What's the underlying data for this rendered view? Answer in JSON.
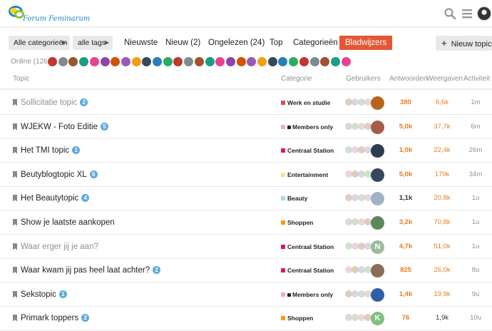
{
  "header": {
    "logo_text": "Forum Feminarum",
    "icons": [
      "search-icon",
      "hamburger-menu-icon",
      "user-avatar"
    ]
  },
  "nav": {
    "categories_dropdown": "Alle categorieën",
    "tags_dropdown": "alle tags",
    "links": [
      "Nieuwste",
      "Nieuw (2)",
      "Ongelezen (24)",
      "Top",
      "Categorieën",
      "Bladwijzers"
    ],
    "active_link": "Bladwijzers",
    "new_topic_label": "Nieuw topic",
    "accent_color": "#e45735"
  },
  "online": {
    "label": "Online (126)"
  },
  "table": {
    "headers": {
      "topic": "Topic",
      "category": "Categorie",
      "users": "Gebruikers",
      "replies": "Antwoorden",
      "views": "Weergaven",
      "activity": "Activiteit"
    },
    "rows": [
      {
        "title": "Sollicitatie topic",
        "badge": "2",
        "read": true,
        "category": "Werk en studie",
        "cat_color": "#e74c3c",
        "locked": false,
        "replies": "380",
        "views": "6,6k",
        "activity": "1m",
        "avatar_letter": "",
        "avatar_color": "#b5651d",
        "reply_color": "#e67e22",
        "view_color": "#e67e22"
      },
      {
        "title": "WJEKW - Foto Editie",
        "badge": "5",
        "read": false,
        "category": "Members only",
        "cat_color": "#f4a6c6",
        "locked": true,
        "replies": "5,0k",
        "views": "37,7k",
        "activity": "6m",
        "avatar_letter": "",
        "avatar_color": "#a35d4a",
        "reply_color": "#e67e22",
        "view_color": "#e67e22"
      },
      {
        "title": "Het TMI topic",
        "badge": "1",
        "read": false,
        "category": "Centraal Station",
        "cat_color": "#d81b60",
        "locked": false,
        "replies": "1,0k",
        "views": "22,4k",
        "activity": "26m",
        "avatar_letter": "",
        "avatar_color": "#2c3e50",
        "reply_color": "#e67e22",
        "view_color": "#e67e22"
      },
      {
        "title": "Beutyblogtopic XL",
        "badge": "6",
        "read": false,
        "category": "Entertainment",
        "cat_color": "#f6e58d",
        "locked": false,
        "replies": "5,0k",
        "views": "179k",
        "activity": "34m",
        "avatar_letter": "",
        "avatar_color": "#34495e",
        "reply_color": "#e67e22",
        "view_color": "#e67e22"
      },
      {
        "title": "Het Beautytopic",
        "badge": "4",
        "read": false,
        "category": "Beauty",
        "cat_color": "#b3d4e8",
        "locked": false,
        "replies": "1,1k",
        "views": "20,8k",
        "activity": "1u",
        "avatar_letter": "",
        "avatar_color": "#9fb3c8",
        "reply_color": "#333333",
        "view_color": "#e67e22"
      },
      {
        "title": "Show je laatste aankopen",
        "badge": "",
        "read": false,
        "category": "Shoppen",
        "cat_color": "#f39c12",
        "locked": false,
        "replies": "3,2k",
        "views": "70,8k",
        "activity": "1u",
        "avatar_letter": "",
        "avatar_color": "#5a8a5a",
        "reply_color": "#e67e22",
        "view_color": "#e67e22"
      },
      {
        "title": "Waar erger jij je aan?",
        "badge": "",
        "read": true,
        "category": "Centraal Station",
        "cat_color": "#d81b60",
        "locked": false,
        "replies": "4,7k",
        "views": "51,0k",
        "activity": "1u",
        "avatar_letter": "N",
        "avatar_color": "#9cba9c",
        "reply_color": "#e67e22",
        "view_color": "#e67e22"
      },
      {
        "title": "Waar kwam jij pas heel laat achter?",
        "badge": "2",
        "read": false,
        "category": "Centraal Station",
        "cat_color": "#d81b60",
        "locked": false,
        "replies": "825",
        "views": "26,0k",
        "activity": "8u",
        "avatar_letter": "",
        "avatar_color": "#8b6b5a",
        "reply_color": "#e67e22",
        "view_color": "#e67e22"
      },
      {
        "title": "Sekstopic",
        "badge": "1",
        "read": false,
        "category": "Members only",
        "cat_color": "#f4a6c6",
        "locked": true,
        "replies": "1,4k",
        "views": "19,9k",
        "activity": "9u",
        "avatar_letter": "",
        "avatar_color": "#2e5ea8",
        "reply_color": "#e67e22",
        "view_color": "#e67e22"
      },
      {
        "title": "Primark toppers",
        "badge": "2",
        "read": false,
        "category": "Shoppen",
        "cat_color": "#f39c12",
        "locked": false,
        "replies": "76",
        "views": "1,9k",
        "activity": "10u",
        "avatar_letter": "K",
        "avatar_color": "#7fbf7f",
        "reply_color": "#e67e22",
        "view_color": "#333333"
      }
    ]
  }
}
